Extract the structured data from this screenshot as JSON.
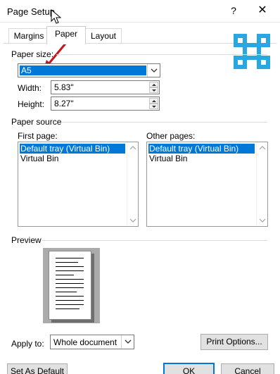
{
  "window": {
    "title": "Page Setup",
    "help_glyph": "?",
    "close_glyph": "✕"
  },
  "tabs": [
    {
      "label": "Margins"
    },
    {
      "label": "Paper"
    },
    {
      "label": "Layout"
    }
  ],
  "paper_size": {
    "section_label": "Paper size:",
    "selected": "A5",
    "width_label": "Width:",
    "width_value": "5.83\"",
    "height_label": "Height:",
    "height_value": "8.27\""
  },
  "paper_source": {
    "section_label": "Paper source",
    "first_page": {
      "label": "First page:",
      "items": [
        "Default tray (Virtual Bin)",
        "Virtual Bin"
      ],
      "selected_index": 0
    },
    "other_pages": {
      "label": "Other pages:",
      "items": [
        "Default tray (Virtual Bin)",
        "Virtual Bin"
      ],
      "selected_index": 0
    }
  },
  "preview": {
    "section_label": "Preview"
  },
  "apply_to": {
    "label": "Apply to:",
    "value": "Whole document"
  },
  "buttons": {
    "print_options": "Print Options...",
    "set_as_default": "Set As Default",
    "ok": "OK",
    "cancel": "Cancel"
  },
  "colors": {
    "accent": "#0078d7",
    "logo": "#29a8e0",
    "annotation_arrow": "#c0181c"
  },
  "icons": {
    "logo": "command-key-icon",
    "annotation": "red-arrow-annotation"
  }
}
